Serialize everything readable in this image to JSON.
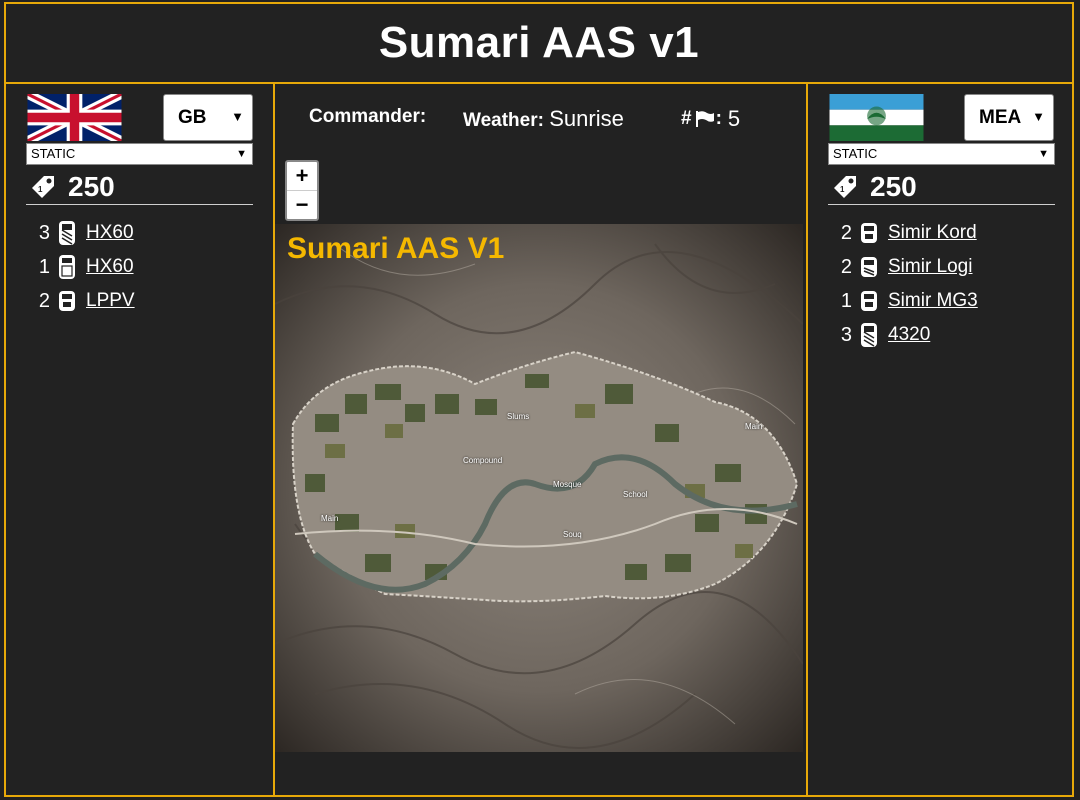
{
  "title": "Sumari AAS v1",
  "colors": {
    "accent": "#e7a909",
    "map_title": "#f5b800",
    "background": "#222222"
  },
  "left_team": {
    "flag": "united-kingdom-flag",
    "faction": "GB",
    "mode": "STATIC",
    "tickets": "250",
    "vehicles": [
      {
        "count": "3",
        "icon": "heavy-vehicle-icon",
        "name": "HX60"
      },
      {
        "count": "1",
        "icon": "truck-icon",
        "name": "HX60"
      },
      {
        "count": "2",
        "icon": "car-icon",
        "name": "LPPV"
      }
    ]
  },
  "right_team": {
    "flag": "mea-flag",
    "faction": "MEA",
    "mode": "STATIC",
    "tickets": "250",
    "vehicles": [
      {
        "count": "2",
        "icon": "car-icon",
        "name": "Simir Kord"
      },
      {
        "count": "2",
        "icon": "logi-truck-icon",
        "name": "Simir Logi"
      },
      {
        "count": "1",
        "icon": "car-icon",
        "name": "Simir MG3"
      },
      {
        "count": "3",
        "icon": "heavy-vehicle-icon",
        "name": "4320"
      }
    ]
  },
  "info": {
    "commander_label": "Commander:",
    "weather_label": "Weather:",
    "weather_value": "Sunrise",
    "flags_label": "#",
    "flags_colon": ":",
    "flags_value": "5"
  },
  "zoom": {
    "in": "+",
    "out": "−"
  },
  "map": {
    "title": "Sumari AAS V1",
    "points": [
      "Slums",
      "Compound",
      "Mosque",
      "School",
      "Souq"
    ],
    "mains": [
      "Main",
      "Main"
    ]
  }
}
